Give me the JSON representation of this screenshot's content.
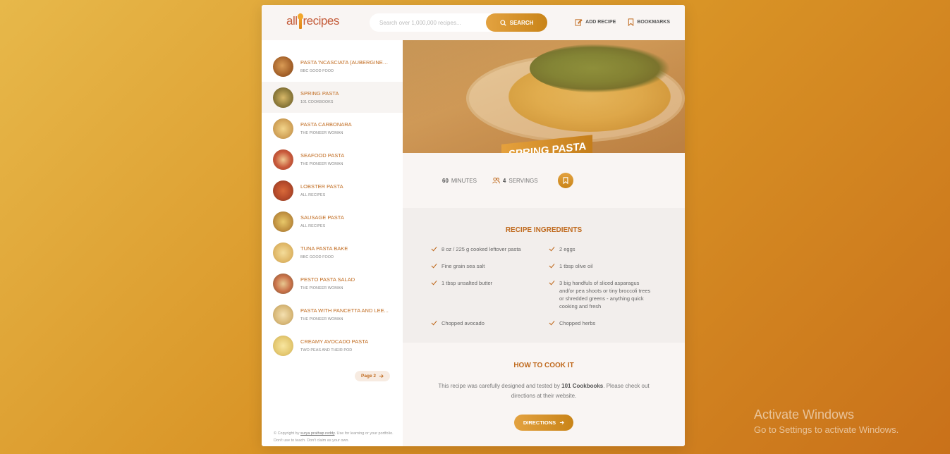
{
  "header": {
    "logo_left": "all",
    "logo_right": "recipes",
    "search_placeholder": "Search over 1,000,000 recipes...",
    "search_label": "SEARCH",
    "add_recipe_label": "ADD RECIPE",
    "bookmarks_label": "BOOKMARKS"
  },
  "results": [
    {
      "title": "PASTA 'NCASCIATA (AUBERGINE ...",
      "publisher": "BBC GOOD FOOD"
    },
    {
      "title": "SPRING PASTA",
      "publisher": "101 COOKBOOKS"
    },
    {
      "title": "PASTA CARBONARA",
      "publisher": "THE PIONEER WOMAN"
    },
    {
      "title": "SEAFOOD PASTA",
      "publisher": "THE PIONEER WOMAN"
    },
    {
      "title": "LOBSTER PASTA",
      "publisher": "ALL RECIPES"
    },
    {
      "title": "SAUSAGE PASTA",
      "publisher": "ALL RECIPES"
    },
    {
      "title": "TUNA PASTA BAKE",
      "publisher": "BBC GOOD FOOD"
    },
    {
      "title": "PESTO PASTA SALAD",
      "publisher": "THE PIONEER WOMAN"
    },
    {
      "title": "PASTA WITH PANCETTA AND LEE...",
      "publisher": "THE PIONEER WOMAN"
    },
    {
      "title": "CREAMY AVOCADO PASTA",
      "publisher": "TWO PEAS AND THEIR POD"
    }
  ],
  "pager": {
    "label": "Page 2"
  },
  "copyright": {
    "prefix": "© Copyright by ",
    "author": "surya prathap reddy",
    "suffix": ". Use for learning or your portfolio. Don't use to teach. Don't claim as your own."
  },
  "recipe": {
    "title": "SPRING PASTA",
    "minutes": "60",
    "minutes_label": "MINUTES",
    "servings": "4",
    "servings_label": "SERVINGS",
    "ingredients_title": "RECIPE INGREDIENTS",
    "ingredients": [
      "8 oz / 225 g cooked leftover pasta",
      "2 eggs",
      "Fine grain sea salt",
      "1 tbsp olive oil",
      "1 tbsp unsalted butter",
      "3 big handfuls of sliced asparagus and/or pea shoots or tiny broccoli trees or shredded greens - anything quick cooking and fresh",
      "Chopped avocado",
      "Chopped herbs"
    ],
    "cook_title": "HOW TO COOK IT",
    "cook_text_before": "This recipe was carefully designed and tested by ",
    "cook_publisher": "101 Cookbooks",
    "cook_text_after": ". Please check out directions at their website.",
    "directions_label": "DIRECTIONS"
  },
  "watermark": {
    "title": "Activate Windows",
    "subtitle": "Go to Settings to activate Windows."
  },
  "colors": {
    "accent": "#c06a1e",
    "gradient_start": "#e3a240",
    "gradient_end": "#c98418"
  }
}
